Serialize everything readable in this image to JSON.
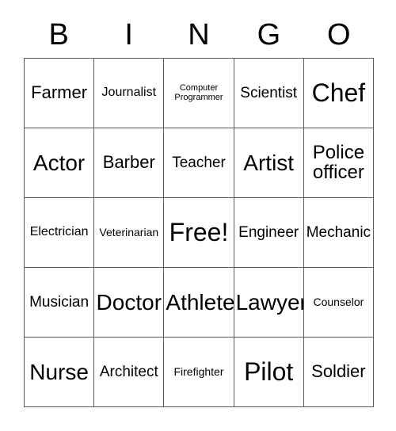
{
  "card": {
    "title": "BINGO",
    "header_letters": [
      "B",
      "I",
      "N",
      "G",
      "O"
    ],
    "colors": {
      "background": "#ffffff",
      "text": "#000000",
      "border": "#5c5c5c"
    },
    "grid_size": "5x5",
    "free_space": "Free!",
    "rows": [
      [
        {
          "label": "Farmer",
          "size": "fs-l"
        },
        {
          "label": "Journalist",
          "size": "fs-m"
        },
        {
          "label": "Computer\nProgrammer",
          "size": "fs-xs"
        },
        {
          "label": "Scientist",
          "size": "fs-ml"
        },
        {
          "label": "Chef",
          "size": "fs-3xl"
        }
      ],
      [
        {
          "label": "Actor",
          "size": "fs-2xl"
        },
        {
          "label": "Barber",
          "size": "fs-l"
        },
        {
          "label": "Teacher",
          "size": "fs-ml"
        },
        {
          "label": "Artist",
          "size": "fs-2xl"
        },
        {
          "label": "Police\nofficer",
          "size": "fs-xl"
        }
      ],
      [
        {
          "label": "Electrician",
          "size": "fs-m"
        },
        {
          "label": "Veterinarian",
          "size": "fs-s"
        },
        {
          "label": "Free!",
          "size": "fs-3xl"
        },
        {
          "label": "Engineer",
          "size": "fs-ml"
        },
        {
          "label": "Mechanic",
          "size": "fs-ml"
        }
      ],
      [
        {
          "label": "Musician",
          "size": "fs-ml"
        },
        {
          "label": "Doctor",
          "size": "fs-2xl"
        },
        {
          "label": "Athlete",
          "size": "fs-2xl"
        },
        {
          "label": "Lawyer",
          "size": "fs-2xl"
        },
        {
          "label": "Counselor",
          "size": "fs-s"
        }
      ],
      [
        {
          "label": "Nurse",
          "size": "fs-2xl"
        },
        {
          "label": "Architect",
          "size": "fs-ml"
        },
        {
          "label": "Firefighter",
          "size": "fs-s"
        },
        {
          "label": "Pilot",
          "size": "fs-3xl"
        },
        {
          "label": "Soldier",
          "size": "fs-l"
        }
      ]
    ]
  }
}
